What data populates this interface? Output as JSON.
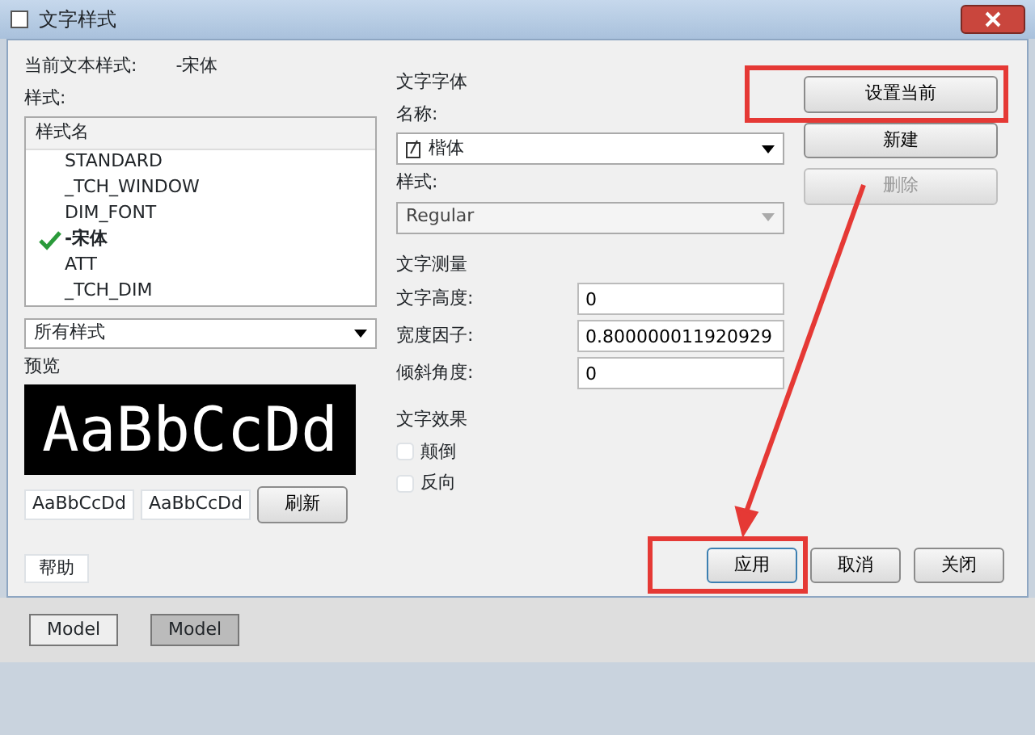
{
  "window": {
    "title": "文字样式"
  },
  "current_style": {
    "label": "当前文本样式:",
    "value": "-宋体"
  },
  "styles_label": "样式:",
  "style_list": {
    "header": "样式名",
    "items": [
      {
        "name": "STANDARD",
        "selected": false
      },
      {
        "name": "_TCH_WINDOW",
        "selected": false
      },
      {
        "name": "DIM_FONT",
        "selected": false
      },
      {
        "name": "-宋体",
        "selected": true
      },
      {
        "name": "ATT",
        "selected": false
      },
      {
        "name": "_TCH_DIM",
        "selected": false
      }
    ]
  },
  "filter": {
    "value": "所有样式"
  },
  "preview": {
    "label": "预览",
    "sample": "AaBbCcDd",
    "small_samples": [
      "AaBbCcDd",
      "AaBbCcDd"
    ],
    "refresh": "刷新"
  },
  "font": {
    "heading": "文字字体",
    "name_label": "名称:",
    "name_value": "楷体",
    "style_label": "样式:",
    "style_value": "Regular",
    "style_disabled": true
  },
  "metrics": {
    "heading": "文字测量",
    "fields": [
      {
        "label": "文字高度:",
        "value": "0"
      },
      {
        "label": "宽度因子:",
        "value": "0.800000011920929"
      },
      {
        "label": "倾斜角度:",
        "value": "0"
      }
    ]
  },
  "effects": {
    "heading": "文字效果",
    "options": [
      {
        "label": "颠倒",
        "checked": false
      },
      {
        "label": "反向",
        "checked": false
      }
    ]
  },
  "side_buttons": [
    {
      "label": "设置当前",
      "disabled": false
    },
    {
      "label": "新建",
      "disabled": false
    },
    {
      "label": "删除",
      "disabled": true
    }
  ],
  "bottom_buttons": [
    {
      "label": "应用",
      "highlighted": true
    },
    {
      "label": "取消",
      "highlighted": false
    },
    {
      "label": "关闭",
      "highlighted": false
    }
  ],
  "help_label": "帮助",
  "model_tabs": [
    {
      "label": "Model",
      "selected": true
    },
    {
      "label": "Model",
      "selected": false
    }
  ]
}
